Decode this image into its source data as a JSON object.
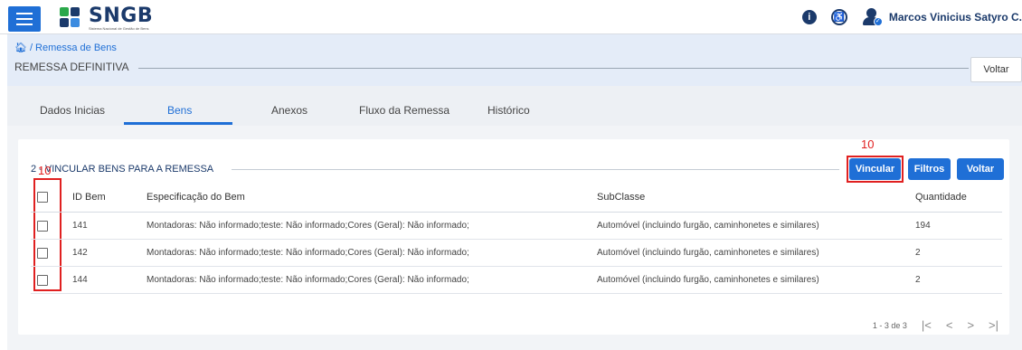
{
  "app": {
    "logo_title": "SNGB",
    "logo_subtitle": "Sistema Nacional de Gestão de Bens",
    "user_name": "Marcos Vinicius Satyro C."
  },
  "breadcrumb": {
    "label": "Remessa de Bens"
  },
  "page": {
    "title": "REMESSA DEFINITIVA",
    "back_label": "Voltar"
  },
  "tabs": [
    {
      "label": "Dados Inicias"
    },
    {
      "label": "Bens",
      "active": true
    },
    {
      "label": "Anexos"
    },
    {
      "label": "Fluxo da Remessa"
    },
    {
      "label": "Histórico"
    }
  ],
  "section": {
    "title": "2 - VINCULAR BENS PARA A REMESSA",
    "buttons": {
      "vincular": "Vincular",
      "filtros": "Filtros",
      "voltar": "Voltar"
    }
  },
  "annotations": {
    "vincular_marker": "10",
    "checkbox_marker": "10"
  },
  "table": {
    "columns": [
      "ID Bem",
      "Especificação do Bem",
      "SubClasse",
      "Quantidade"
    ],
    "rows": [
      {
        "id": "141",
        "spec": "Montadoras: Não informado;teste: Não informado;Cores (Geral): Não informado;",
        "subclass": "Automóvel (incluindo furgão, caminhonetes e similares)",
        "qty": "194"
      },
      {
        "id": "142",
        "spec": "Montadoras: Não informado;teste: Não informado;Cores (Geral): Não informado;",
        "subclass": "Automóvel (incluindo furgão, caminhonetes e similares)",
        "qty": "2"
      },
      {
        "id": "144",
        "spec": "Montadoras: Não informado;teste: Não informado;Cores (Geral): Não informado;",
        "subclass": "Automóvel (incluindo furgão, caminhonetes e similares)",
        "qty": "2"
      }
    ]
  },
  "paginator": {
    "range": "1 - 3 de 3"
  },
  "colors": {
    "primary": "#1f6fd6",
    "brand_dark": "#1b3a6b",
    "annotation_red": "#e02020",
    "subheader_bg": "#e4ecf8"
  }
}
